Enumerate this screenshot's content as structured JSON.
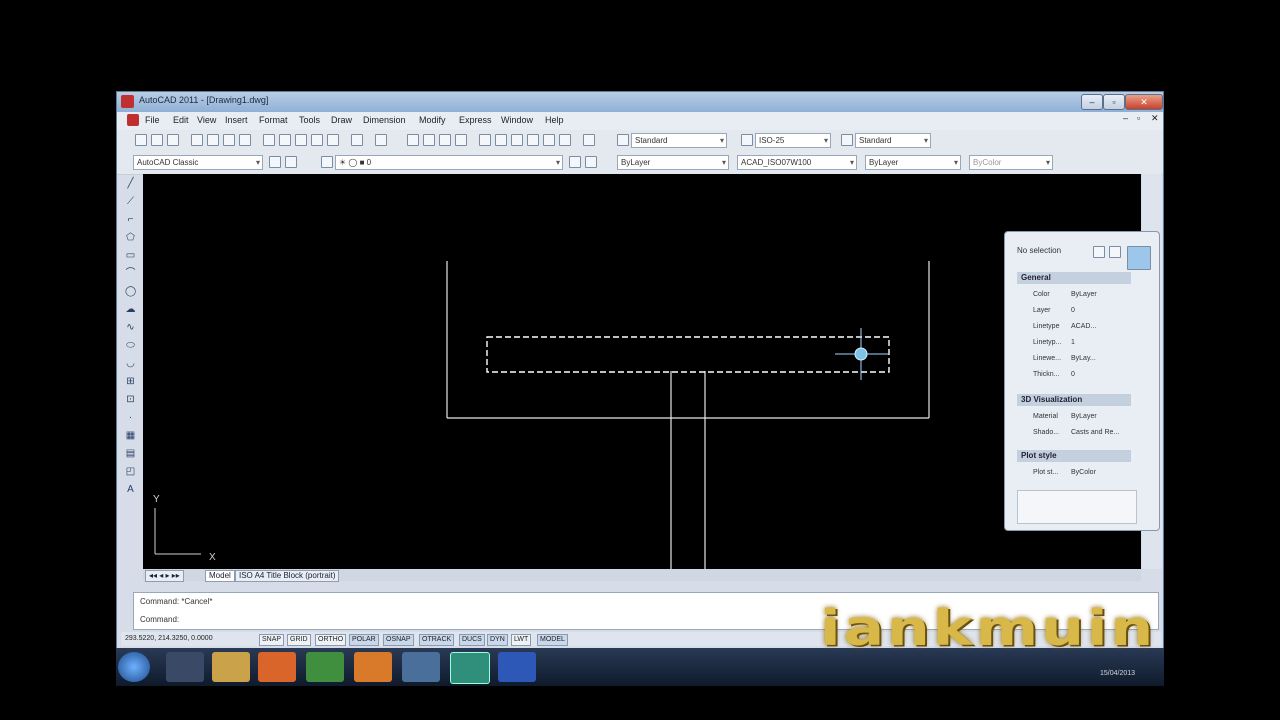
{
  "window": {
    "title": "AutoCAD 2011 - [Drawing1.dwg]"
  },
  "menu": [
    "File",
    "Edit",
    "View",
    "Insert",
    "Format",
    "Tools",
    "Draw",
    "Dimension",
    "Modify",
    "Express",
    "Window",
    "Help"
  ],
  "toolbars": {
    "text_style": "Standard",
    "dim_style": "ISO-25",
    "table_style": "Standard",
    "workspace": "AutoCAD Classic",
    "layer_value": "0",
    "color_combo": "ByLayer",
    "linetype_combo": "ACAD_ISO07W100",
    "lineweight_combo": "ByLayer",
    "plotstyle_combo": "ByColor"
  },
  "layout_tabs": [
    "Model",
    "ISO A4 Title Block (portrait)"
  ],
  "command": {
    "history": "Command: *Cancel*",
    "prompt": "Command:"
  },
  "status": {
    "coords": "293.5220, 214.3250, 0.0000",
    "toggles": [
      "SNAP",
      "GRID",
      "ORTHO",
      "POLAR",
      "OSNAP",
      "OTRACK",
      "DUCS",
      "DYN",
      "LWT",
      "MODEL"
    ],
    "active": [
      "POLAR",
      "OSNAP",
      "OTRACK",
      "DUCS",
      "DYN",
      "MODEL"
    ]
  },
  "properties": {
    "selection": "No selection",
    "general_header": "General",
    "general": [
      {
        "k": "Color",
        "v": "ByLayer"
      },
      {
        "k": "Layer",
        "v": "0"
      },
      {
        "k": "Linetype",
        "v": "ACAD..."
      },
      {
        "k": "Linetyp...",
        "v": "1"
      },
      {
        "k": "Linewe...",
        "v": "ByLay..."
      },
      {
        "k": "Thickn...",
        "v": "0"
      }
    ],
    "viz_header": "3D Visualization",
    "viz": [
      {
        "k": "Material",
        "v": "ByLayer"
      },
      {
        "k": "Shado...",
        "v": "Casts and Re..."
      }
    ],
    "plot_header": "Plot style",
    "plot": [
      {
        "k": "Plot st...",
        "v": "ByColor"
      }
    ]
  },
  "ucs": {
    "x": "X",
    "y": "Y"
  },
  "watermark": "iankmuin",
  "taskbar": {
    "clock": "15/04/2013"
  },
  "colors": {
    "canvas": "#000000",
    "lines": "#e6e6e6",
    "selection": "#ffffff",
    "accent": "#d9b84a"
  }
}
